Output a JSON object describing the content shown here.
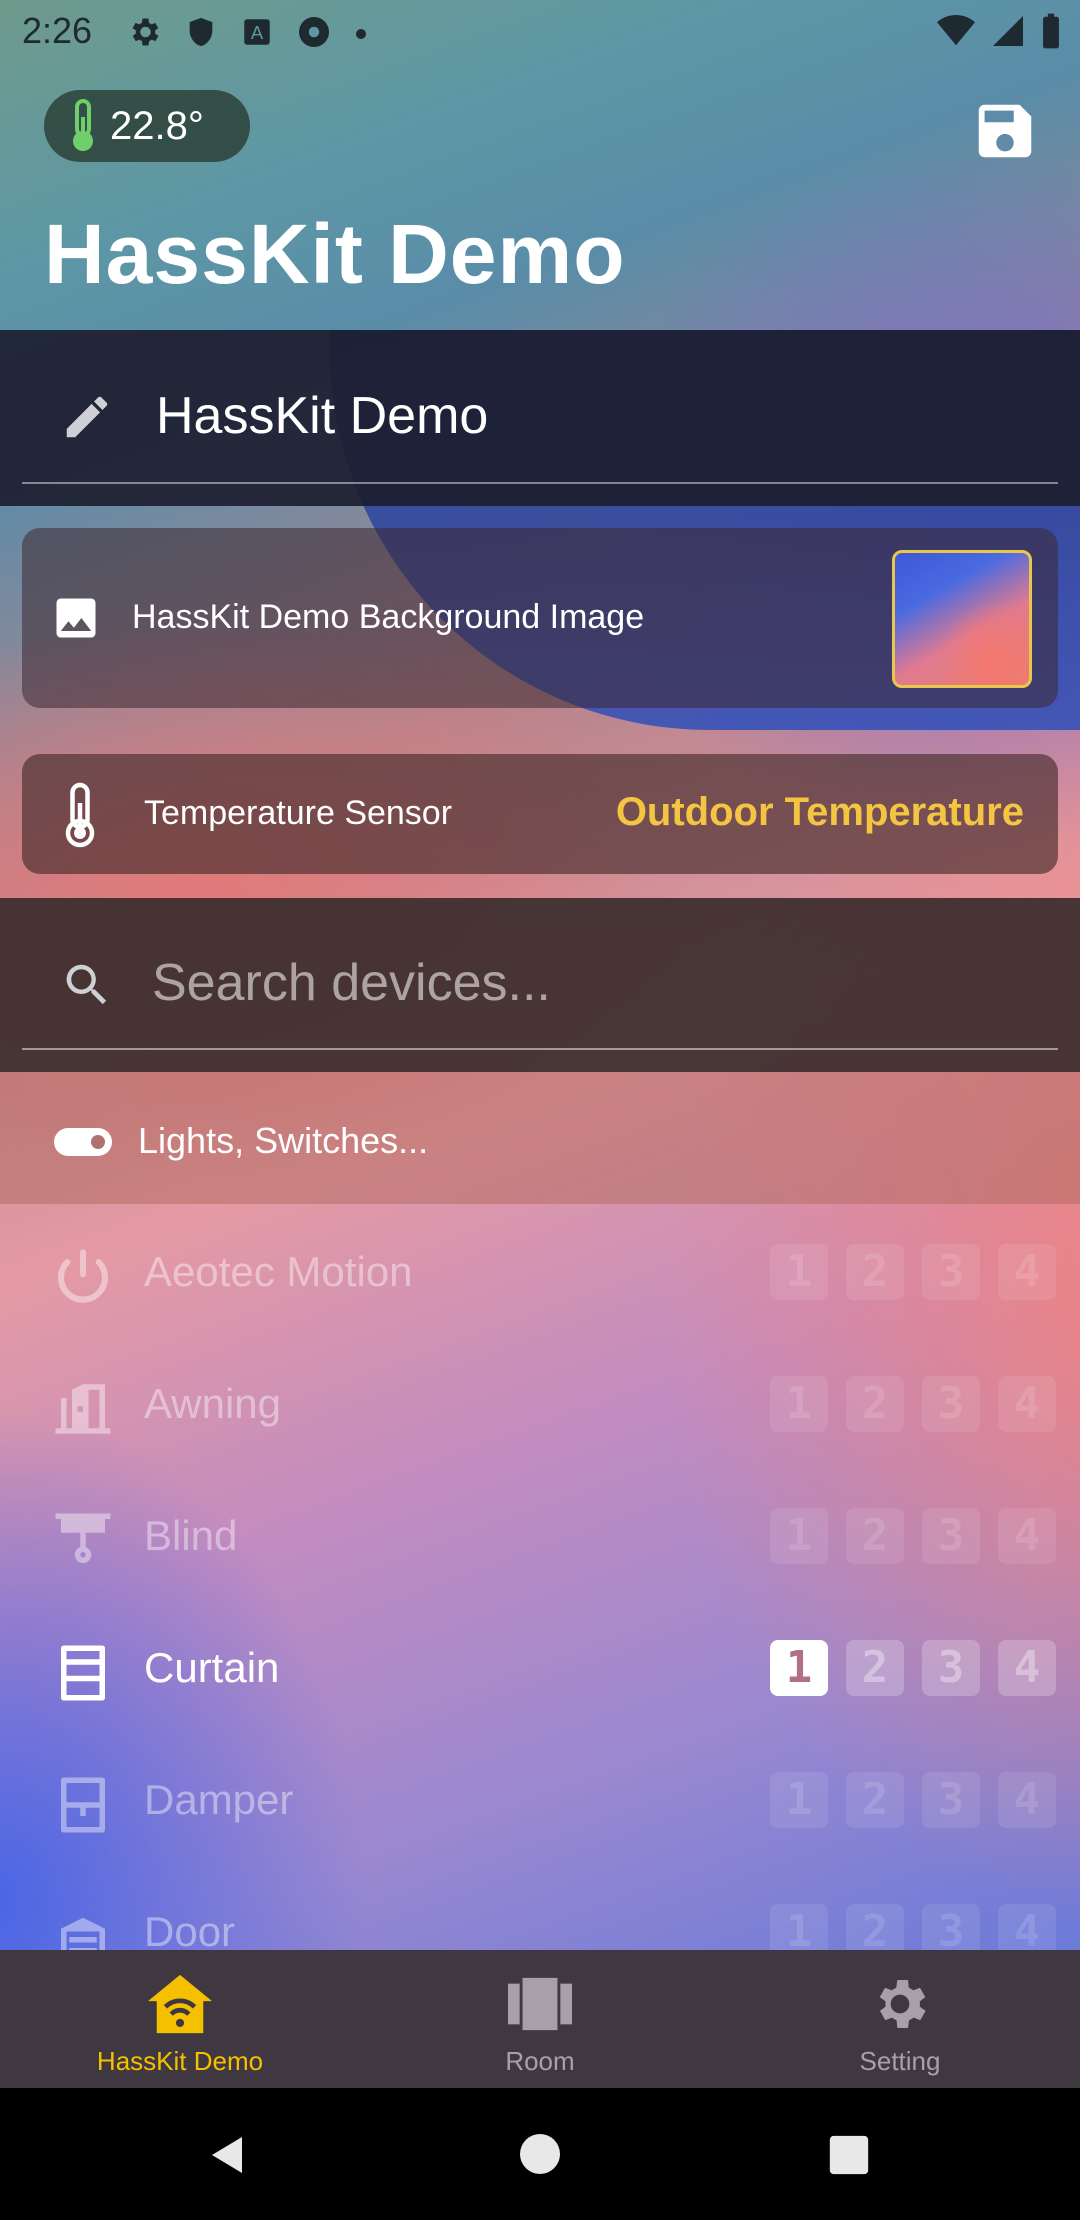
{
  "status_bar": {
    "time": "2:26"
  },
  "header": {
    "temperature": "22.8°",
    "title": "HassKit Demo"
  },
  "name_field": {
    "value": "HassKit Demo"
  },
  "background_card": {
    "label": "HassKit Demo Background Image"
  },
  "temperature_card": {
    "label": "Temperature Sensor",
    "value": "Outdoor Temperature"
  },
  "search": {
    "placeholder": "Search devices..."
  },
  "filter": {
    "label": "Lights, Switches..."
  },
  "devices": [
    {
      "name": "Aeotec Motion",
      "icon": "power-icon",
      "active_slot": 0
    },
    {
      "name": "Awning",
      "icon": "awning-icon",
      "active_slot": 0
    },
    {
      "name": "Blind",
      "icon": "blind-icon",
      "active_slot": 0
    },
    {
      "name": "Curtain",
      "icon": "curtain-icon",
      "active_slot": 1
    },
    {
      "name": "Damper",
      "icon": "damper-icon",
      "active_slot": 0
    },
    {
      "name": "Door",
      "icon": "door-icon",
      "active_slot": 0
    }
  ],
  "slot_labels": [
    "1",
    "2",
    "3",
    "4"
  ],
  "nav": {
    "items": [
      {
        "label": "HassKit Demo",
        "icon": "home-wifi-icon"
      },
      {
        "label": "Room",
        "icon": "room-icon"
      },
      {
        "label": "Setting",
        "icon": "gear-icon"
      }
    ],
    "active_index": 0
  },
  "colors": {
    "accent": "#f4c542",
    "nav_active": "#f4c000",
    "nav_bg": "#3f3840"
  }
}
